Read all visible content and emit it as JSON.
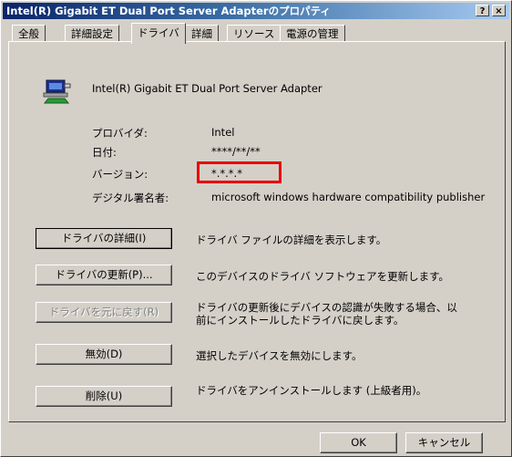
{
  "window": {
    "title": "Intel(R) Gigabit ET Dual Port Server Adapterのプロパティ"
  },
  "title_buttons": {
    "help": "?",
    "close": "×"
  },
  "tabs": [
    {
      "label": "全般"
    },
    {
      "label": "詳細設定"
    },
    {
      "label": "ドライバ",
      "active": true
    },
    {
      "label": "詳細"
    },
    {
      "label": "リソース"
    },
    {
      "label": "電源の管理"
    }
  ],
  "device": {
    "name": "Intel(R) Gigabit ET Dual Port Server Adapter",
    "icon": "network-adapter-icon"
  },
  "info": {
    "provider_label": "プロバイダ:",
    "provider_value": "Intel",
    "date_label": "日付:",
    "date_value": "****/**/**",
    "version_label": "バージョン:",
    "version_value": "*.*.*.*",
    "signer_label": "デジタル署名者:",
    "signer_value": "microsoft windows hardware compatibility publisher"
  },
  "actions": [
    {
      "button": "ドライバの詳細(I)",
      "desc": "ドライバ ファイルの詳細を表示します。"
    },
    {
      "button": "ドライバの更新(P)...",
      "desc": "このデバイスのドライバ ソフトウェアを更新します。"
    },
    {
      "button": "ドライバを元に戻す(R)",
      "desc1": "ドライバの更新後にデバイスの認識が失敗する場合、以",
      "desc2": "前にインストールしたドライバに戻します。"
    },
    {
      "button": "無効(D)",
      "desc": "選択したデバイスを無効にします。"
    },
    {
      "button": "削除(U)",
      "desc": "ドライバをアンインストールします (上級者用)。"
    }
  ],
  "footer": {
    "ok": "OK",
    "cancel": "キャンセル"
  },
  "colors": {
    "title_start": "#0a246a",
    "title_end": "#a6caf0",
    "face": "#d4d0c8",
    "highlight": "#e8000b"
  }
}
